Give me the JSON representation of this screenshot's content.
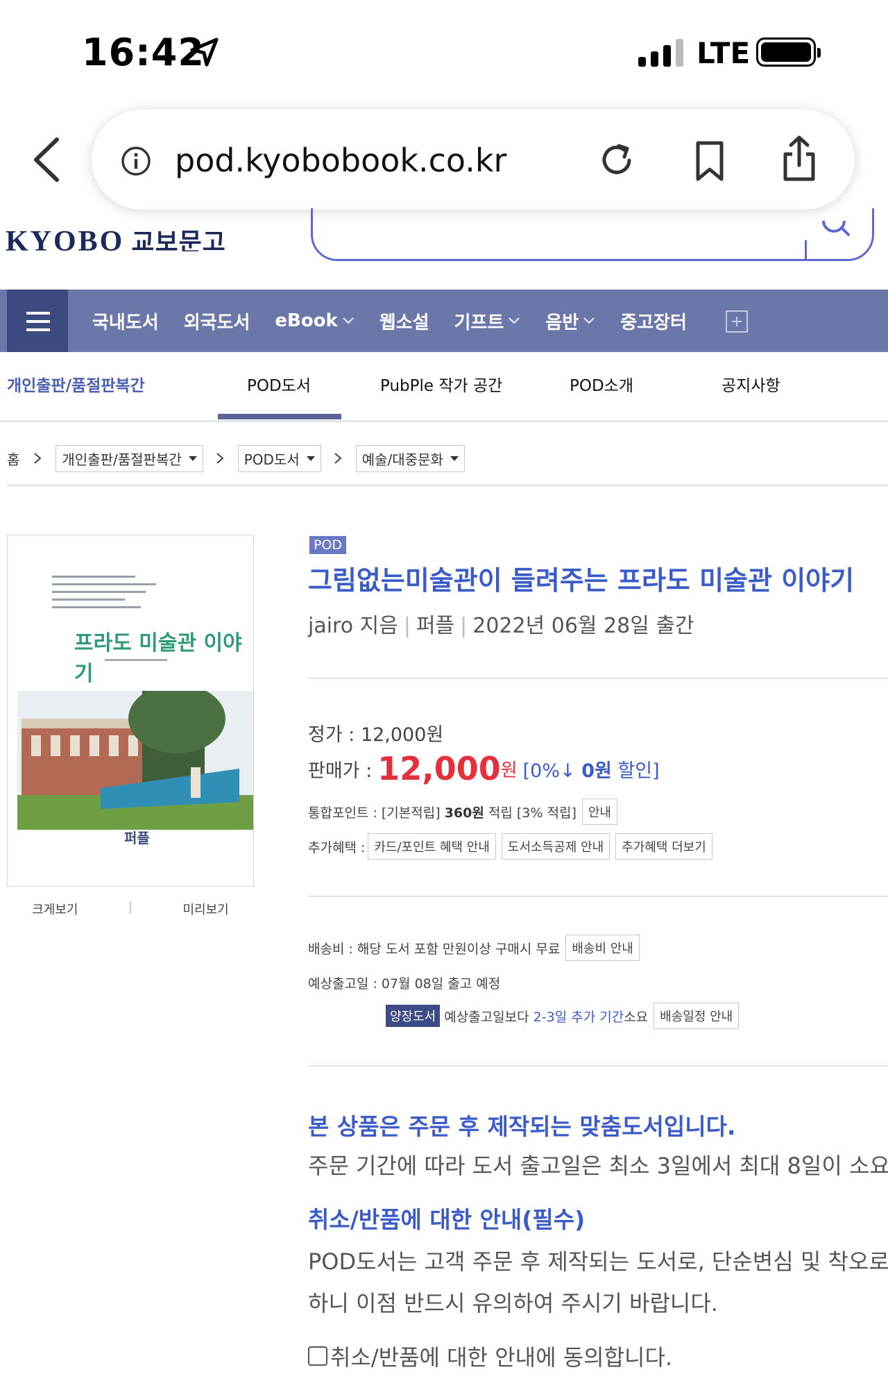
{
  "status_bar": {
    "time": "16:42",
    "network": "LTE"
  },
  "browser": {
    "url": "pod.kyobobook.co.kr"
  },
  "site": {
    "logo_en": "KYOBO",
    "logo_kr": "교보문고"
  },
  "nav": {
    "items": [
      {
        "label": "국내도서",
        "dropdown": false
      },
      {
        "label": "외국도서",
        "dropdown": false
      },
      {
        "label": "eBook",
        "dropdown": true
      },
      {
        "label": "웹소설",
        "dropdown": false
      },
      {
        "label": "기프트",
        "dropdown": true
      },
      {
        "label": "음반",
        "dropdown": true
      },
      {
        "label": "중고장터",
        "dropdown": false
      }
    ]
  },
  "subnav": {
    "brand": "개인출판/품절판복간",
    "tabs": [
      "POD도서",
      "PubPle 작가 공간",
      "POD소개",
      "공지사항"
    ],
    "active_tab": "POD도서"
  },
  "breadcrumb": {
    "home": "홈",
    "levels": [
      "개인출판/품절판복간",
      "POD도서",
      "예술/대중문화"
    ]
  },
  "cover": {
    "title": "프라도 미술관 이야기",
    "publisher": "퍼플",
    "links": [
      "크게보기",
      "미리보기"
    ]
  },
  "product": {
    "badge": "POD",
    "title": "그림없는미술관이 들려주는 프라도 미술관 이야기",
    "author": "jairo 지음",
    "publisher": "퍼플",
    "date": "2022년 06월 28일 출간",
    "list_price_label": "정가 : 12,000원",
    "sale_price_label": "판매가 :",
    "sale_price": "12,000",
    "sale_unit": "원",
    "discount_open": "[0%",
    "discount_arrow": "↓",
    "discount_amount": "0원",
    "discount_close": "할인]",
    "points_label": "통합포인트 : [기본적립]",
    "points_amount": "360원",
    "points_rest": "적립 [3% 적립]",
    "points_btn": "안내",
    "benefits_label": "추가혜택 :",
    "benefits_btns": [
      "카드/포인트 혜택 안내",
      "도서소득공제 안내",
      "추가혜택 더보기"
    ],
    "shipping": "배송비 : 해당 도서 포함 만원이상 구매시 무료",
    "shipping_btn": "배송비 안내",
    "eta": "예상출고일 : 07월 08일 출고 예정",
    "hardcover_badge": "양장도서",
    "eta_note_pre": "예상출고일보다",
    "eta_note_blue": "2-3일 추가 기간",
    "eta_note_post": "소요",
    "eta_btn": "배송일정 안내"
  },
  "notice": {
    "heading1": "본 상품은 주문 후 제작되는 맞춤도서입니다.",
    "text1": "주문 기간에 따라 도서 출고일은 최소 3일에서 최대 8일이 소요",
    "heading2": "취소/반품에 대한 안내(필수)",
    "text2a": "POD도서는 고객 주문 후 제작되는 도서로, 단순변심 및 착오로",
    "text2b": "하니 이점 반드시 유의하여 주시기 바랍니다.",
    "agree": "취소/반품에 대한 안내에 동의합니다."
  },
  "colors": {
    "accent": "#3b5bc8",
    "nav_bg": "#6b77a9",
    "price": "#e3303c"
  }
}
